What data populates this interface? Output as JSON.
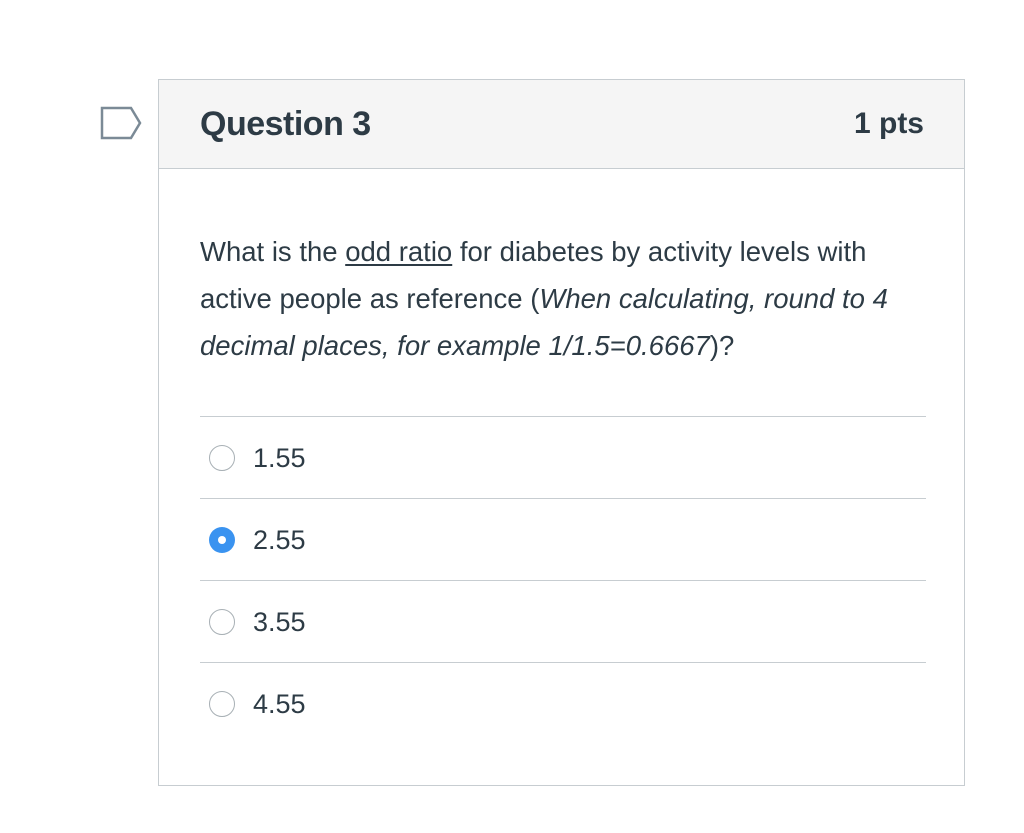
{
  "question": {
    "title": "Question 3",
    "points": "1 pts",
    "text_parts": {
      "p1": "What is the ",
      "underlined": "odd ratio",
      "p2": " for diabetes by activity levels with active people as reference (",
      "italic": "When calculating, round to 4 decimal places, for example 1/1.5=0.6667",
      "p3": ")?"
    }
  },
  "flag": {
    "icon": "flag-outline-icon",
    "color": "#7b8a96"
  },
  "answers": [
    {
      "label": "1.55",
      "selected": false
    },
    {
      "label": "2.55",
      "selected": true
    },
    {
      "label": "3.55",
      "selected": false
    },
    {
      "label": "4.55",
      "selected": false
    }
  ],
  "colors": {
    "text": "#2d3b45",
    "header_bg": "#f5f5f5",
    "border": "#c7cdd1",
    "selected_radio": "#3a93f0"
  }
}
